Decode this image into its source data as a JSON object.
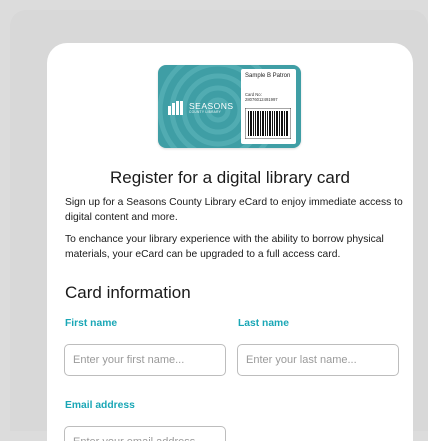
{
  "card": {
    "brand_name": "SEASONS",
    "brand_sub": "COUNTY LIBRARY",
    "patron_name": "Sample B Patron",
    "card_no_label": "Card No:",
    "card_no": "28076012491997",
    "color": "#3f9ea5"
  },
  "page": {
    "title": "Register for a digital library card",
    "intro": "Sign up for a Seasons County Library eCard to enjoy immediate access to digital content and more.",
    "upgrade_note": "To enchance your library experience with the ability to borrow physical materials, your eCard can be upgraded to a full access card."
  },
  "form": {
    "section_title": "Card information",
    "first_name": {
      "label": "First name",
      "placeholder": "Enter your first name...",
      "value": ""
    },
    "last_name": {
      "label": "Last name",
      "placeholder": "Enter your last name...",
      "value": ""
    },
    "email": {
      "label": "Email address",
      "placeholder": "Enter your email address...",
      "value": ""
    },
    "label_color": "#1aa7b6"
  }
}
